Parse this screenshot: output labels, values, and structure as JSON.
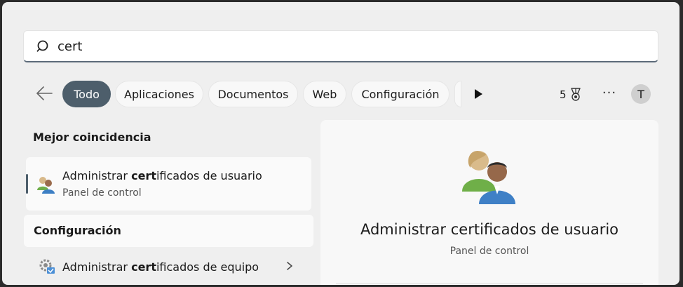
{
  "search": {
    "query": "cert",
    "icon": "search-icon"
  },
  "filters": {
    "back_icon": "arrow-left-icon",
    "chips": [
      {
        "label": "Todo",
        "active": true
      },
      {
        "label": "Aplicaciones",
        "active": false
      },
      {
        "label": "Documentos",
        "active": false
      },
      {
        "label": "Web",
        "active": false
      },
      {
        "label": "Configuración",
        "active": false
      }
    ],
    "more_icon": "play-arrow-icon",
    "points_value": "5",
    "points_icon": "medal-icon",
    "overflow_icon": "more-dots-icon",
    "overflow_label": "···",
    "avatar_initial": "T"
  },
  "best_match": {
    "section_label": "Mejor coincidencia",
    "item": {
      "title_prefix": "Administrar ",
      "title_match": "cert",
      "title_suffix": "ificados de usuario",
      "subtitle": "Panel de control",
      "icon": "users-icon"
    }
  },
  "settings_section": {
    "section_label": "Configuración",
    "items": [
      {
        "title_prefix": "Administrar ",
        "title_match": "cert",
        "title_suffix": "ificados de equipo",
        "icon": "certificate-gear-icon",
        "chevron_icon": "chevron-right-icon"
      }
    ]
  },
  "detail": {
    "title": "Administrar certificados de usuario",
    "subtitle": "Panel de control",
    "icon": "users-icon"
  },
  "colors": {
    "accent": "#4d5e6b",
    "background": "#efefef",
    "card": "#fafafa"
  }
}
